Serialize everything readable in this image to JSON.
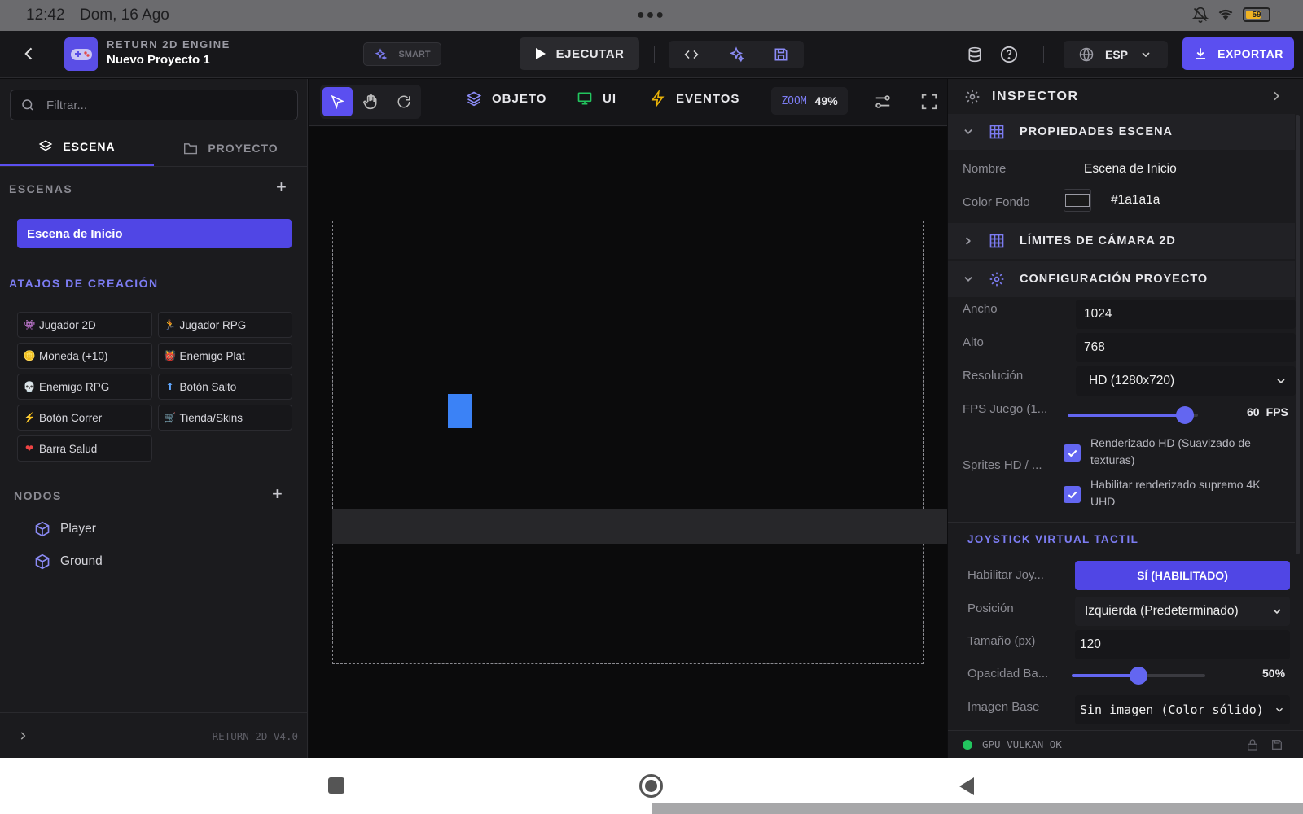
{
  "status_bar": {
    "time": "12:42",
    "date": "Dom, 16 Ago",
    "battery": "59",
    "icons": [
      "bell-off-icon",
      "wifi-icon",
      "battery-icon"
    ]
  },
  "header": {
    "engine_name": "RETURN 2D ENGINE",
    "project_name": "Nuevo Proyecto 1",
    "smart_label": "SMART",
    "run_label": "EJECUTAR",
    "language": "ESP",
    "export_label": "EXPORTAR"
  },
  "left_panel": {
    "filter_placeholder": "Filtrar...",
    "tabs": [
      {
        "label": "ESCENA",
        "active": true
      },
      {
        "label": "PROYECTO",
        "active": false
      }
    ],
    "scenes_header": "ESCENAS",
    "scenes": [
      "Escena de Inicio"
    ],
    "shortcuts_header": "ATAJOS DE CREACIÓN",
    "shortcuts": [
      {
        "emoji": "👾",
        "label": "Jugador 2D"
      },
      {
        "emoji": "🏃",
        "label": "Jugador RPG"
      },
      {
        "emoji": "🪙",
        "label": "Moneda (+10)"
      },
      {
        "emoji": "👹",
        "label": "Enemigo Plat"
      },
      {
        "emoji": "💀",
        "label": "Enemigo RPG"
      },
      {
        "emoji": "⬆",
        "label": "Botón Salto"
      },
      {
        "emoji": "⚡",
        "label": "Botón Correr"
      },
      {
        "emoji": "🛒",
        "label": "Tienda/Skins"
      },
      {
        "emoji": "❤",
        "label": "Barra Salud"
      }
    ],
    "nodes_header": "NODOS",
    "nodes": [
      "Player",
      "Ground"
    ],
    "version": "RETURN 2D V4.0"
  },
  "canvas": {
    "tabs": [
      "OBJETO",
      "UI",
      "EVENTOS"
    ],
    "zoom_label": "ZOOM",
    "zoom_value": "49%"
  },
  "inspector": {
    "title": "INSPECTOR",
    "scene_props_header": "PROPIEDADES ESCENA",
    "name_label": "Nombre",
    "name_value": "Escena de Inicio",
    "bg_color_label": "Color Fondo",
    "bg_color_value": "#1a1a1a",
    "camera_limits_header": "LÍMITES DE CÁMARA 2D",
    "project_config_header": "CONFIGURACIÓN PROYECTO",
    "width_label": "Ancho",
    "width_value": "1024",
    "height_label": "Alto",
    "height_value": "768",
    "resolution_label": "Resolución",
    "resolution_value": "HD (1280x720)",
    "fps_label": "FPS Juego (1...",
    "fps_value": "60",
    "fps_unit": "FPS",
    "fps_level": 0.9,
    "sprites_label": "Sprites HD / ...",
    "check1_line1": "Renderizado HD (Suavizado de",
    "check1_line2": "texturas)",
    "check2_line1": "Habilitar renderizado supremo 4K",
    "check2_line2": "UHD",
    "joystick_header": "JOYSTICK VIRTUAL TACTIL",
    "enable_joy_label": "Habilitar Joy...",
    "enable_joy_value": "SÍ (HABILITADO)",
    "position_label": "Posición",
    "position_value": "Izquierda (Predeterminado)",
    "size_label": "Tamaño (px)",
    "size_value": "120",
    "opacity_label": "Opacidad Ba...",
    "opacity_value": "50%",
    "opacity_level": 0.5,
    "base_image_label": "Imagen Base",
    "base_image_value": "Sin imagen (Color sólido)",
    "footer_status": "GPU VULKAN OK"
  },
  "colors": {
    "accent": "#5b4ff0",
    "player": "#3b82f6",
    "ui_tab_icon": "#22c55e",
    "events_tab_icon": "#eab308",
    "status_ok": "#22c55e"
  }
}
